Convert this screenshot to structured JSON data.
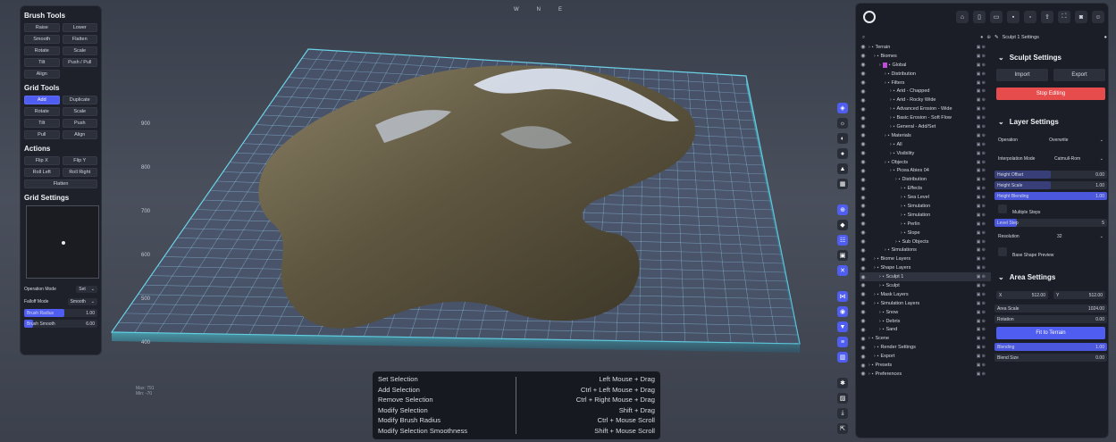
{
  "compass": [
    "W",
    "N",
    "E"
  ],
  "left": {
    "brush_title": "Brush Tools",
    "brush_buttons": [
      "Raise",
      "Lower",
      "Smooth",
      "Flatten",
      "Rotate",
      "Scale",
      "Tilt",
      "Push / Pull",
      "Align"
    ],
    "grid_title": "Grid Tools",
    "grid_buttons": [
      "Add",
      "Duplicate",
      "Rotate",
      "Scale",
      "Tilt",
      "Push",
      "Pull",
      "Align"
    ],
    "actions_title": "Actions",
    "action_buttons": [
      "Flip X",
      "Flip Y",
      "Roll Left",
      "Roll Right",
      "Flatten"
    ],
    "settings_title": "Grid Settings",
    "operation_mode_label": "Operation Mode",
    "operation_mode_value": "Set",
    "falloff_mode_label": "Falloff Mode",
    "falloff_mode_value": "Smooth",
    "brush_radius_label": "Brush Radius",
    "brush_radius_value": "1.00",
    "brush_smooth_label": "Brush Smooth",
    "brush_smooth_value": "6.00"
  },
  "viewport": {
    "ruler_labels": [
      "900",
      "800",
      "700",
      "600",
      "500",
      "400"
    ],
    "max_label": "Max: 791",
    "min_label": "Min: -70"
  },
  "tree": {
    "rows": [
      {
        "label": "Terrain",
        "indent": 0,
        "icon": "terrain-icon"
      },
      {
        "label": "Biomes",
        "indent": 1,
        "icon": "folder-icon"
      },
      {
        "label": "Global",
        "indent": 2,
        "icon": "biome-icon"
      },
      {
        "label": "Distribution",
        "indent": 3,
        "icon": "folder-icon"
      },
      {
        "label": "Filters",
        "indent": 3,
        "icon": "folder-icon"
      },
      {
        "label": "Arid - Chapped",
        "indent": 4,
        "icon": "filter-icon"
      },
      {
        "label": "Arid - Rocky Wide",
        "indent": 4,
        "icon": "filter-icon"
      },
      {
        "label": "Advanced Erosion - Wide",
        "indent": 4,
        "icon": "filter-icon"
      },
      {
        "label": "Basic Erosion - Soft Flow",
        "indent": 4,
        "icon": "filter-icon"
      },
      {
        "label": "General - Add/Set",
        "indent": 4,
        "icon": "filter-icon"
      },
      {
        "label": "Materials",
        "indent": 3,
        "icon": "folder-icon"
      },
      {
        "label": "All",
        "indent": 4,
        "icon": "material-icon"
      },
      {
        "label": "Visibility",
        "indent": 4,
        "icon": "material-icon"
      },
      {
        "label": "Objects",
        "indent": 3,
        "icon": "folder-icon"
      },
      {
        "label": "Picea Abies 04",
        "indent": 4,
        "icon": "object-icon"
      },
      {
        "label": "Distribution",
        "indent": 5,
        "icon": "folder-icon"
      },
      {
        "label": "Effects",
        "indent": 6,
        "icon": "effect-icon"
      },
      {
        "label": "Sea Level",
        "indent": 6,
        "icon": "effect-icon"
      },
      {
        "label": "Simulation",
        "indent": 6,
        "icon": "effect-icon"
      },
      {
        "label": "Simulation",
        "indent": 6,
        "icon": "effect-icon"
      },
      {
        "label": "Perlin",
        "indent": 6,
        "icon": "effect-icon"
      },
      {
        "label": "Slope",
        "indent": 6,
        "icon": "effect-icon"
      },
      {
        "label": "Sub Objects",
        "indent": 5,
        "icon": "folder-icon"
      },
      {
        "label": "Simulations",
        "indent": 3,
        "icon": "folder-icon"
      },
      {
        "label": "Biome Layers",
        "indent": 1,
        "icon": "layers-icon"
      },
      {
        "label": "Shape Layers",
        "indent": 1,
        "icon": "layers-icon"
      },
      {
        "label": "Sculpt 1",
        "indent": 2,
        "icon": "sculpt-icon",
        "selected": true
      },
      {
        "label": "Sculpt",
        "indent": 2,
        "icon": "sculpt-icon"
      },
      {
        "label": "Mask Layers",
        "indent": 1,
        "icon": "layers-icon"
      },
      {
        "label": "Simulation Layers",
        "indent": 1,
        "icon": "layers-icon"
      },
      {
        "label": "Snow",
        "indent": 2,
        "icon": "sim-icon"
      },
      {
        "label": "Debris",
        "indent": 2,
        "icon": "sim-icon"
      },
      {
        "label": "Sand",
        "indent": 2,
        "icon": "sim-icon"
      },
      {
        "label": "Scene",
        "indent": 0,
        "icon": "scene-icon"
      },
      {
        "label": "Render Settings",
        "indent": 1,
        "icon": "render-icon"
      },
      {
        "label": "Export",
        "indent": 1,
        "icon": "export-icon"
      },
      {
        "label": "Presets",
        "indent": 0,
        "icon": "preset-icon"
      },
      {
        "label": "Preferences",
        "indent": 0,
        "icon": "gear-icon"
      }
    ]
  },
  "settings": {
    "header": "Sculpt 1 Settings",
    "sculpt_title": "Sculpt Settings",
    "import_label": "Import",
    "export_label": "Export",
    "stop_label": "Stop Editing",
    "layer_title": "Layer Settings",
    "operation_label": "Operation",
    "operation_value": "Overwrite",
    "interp_label": "Interpolation Mode",
    "interp_value": "Catmull-Rom",
    "height_offset_label": "Height Offset",
    "height_offset_value": "0.00",
    "height_scale_label": "Height Scale",
    "height_scale_value": "1.00",
    "height_blending_label": "Height Blending",
    "height_blending_value": "1.00",
    "multiple_steps_label": "Multiple Steps",
    "level_step_label": "Level Step",
    "level_step_value": "5",
    "resolution_label": "Resolution",
    "resolution_value": "32",
    "base_shape_label": "Base Shape Preview",
    "area_title": "Area Settings",
    "x_label": "X",
    "x_value": "512.00",
    "y_label": "Y",
    "y_value": "512.00",
    "area_scale_label": "Area Scale",
    "area_scale_value": "1024.00",
    "rotation_label": "Rotation",
    "rotation_value": "0.00",
    "fit_label": "Fit to Terrain",
    "blending_label": "Blending",
    "blending_value": "1.00",
    "blend_size_label": "Blend Size",
    "blend_size_value": "0.00"
  },
  "shortcuts": [
    {
      "action": "Set Selection",
      "keys": "Left Mouse + Drag"
    },
    {
      "action": "Add Selection",
      "keys": "Ctrl + Left Mouse + Drag"
    },
    {
      "action": "Remove Selection",
      "keys": "Ctrl + Right Mouse + Drag"
    },
    {
      "action": "Modify Selection",
      "keys": "Shift + Drag"
    },
    {
      "action": "Modify Brush Radius",
      "keys": "Ctrl + Mouse Scroll"
    },
    {
      "action": "Modify Selection Smoothness",
      "keys": "Shift + Mouse Scroll"
    }
  ],
  "colors": {
    "accent": "#4f5df0",
    "stop": "#e74c4c",
    "grid": "#6ad2e6"
  }
}
